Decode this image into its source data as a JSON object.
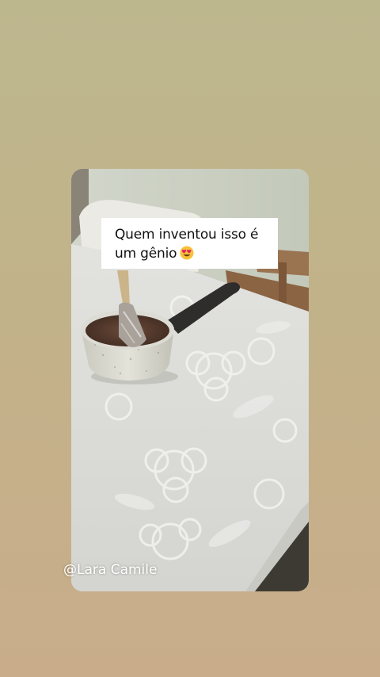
{
  "story": {
    "caption_line1": "Quem inventou isso é",
    "caption_line2": "um gênio",
    "caption_emoji": "heart-eyes-emoji",
    "username": "@Lara Camile"
  },
  "colors": {
    "background_top": "#bdb78e",
    "background_bottom": "#c9ad8a",
    "caption_box": "#ffffff",
    "username_text": "#ffffff"
  }
}
